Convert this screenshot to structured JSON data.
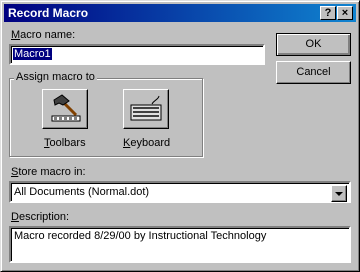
{
  "window": {
    "title": "Record Macro",
    "help_label": "?",
    "close_label": "×"
  },
  "form": {
    "macro_name_prefix": "M",
    "macro_name_rest": "acro name:",
    "macro_name_value": "Macro1",
    "assign_legend": "Assign macro to",
    "toolbars_prefix": "T",
    "toolbars_rest": "oolbars",
    "keyboard_prefix": "K",
    "keyboard_rest": "eyboard",
    "store_prefix": "S",
    "store_rest": "tore macro in:",
    "store_value": "All Documents (Normal.dot)",
    "description_prefix": "D",
    "description_rest": "escription:",
    "description_value": "Macro recorded 8/29/00 by Instructional Technology"
  },
  "buttons": {
    "ok": "OK",
    "cancel": "Cancel"
  },
  "icons": {
    "toolbars": "hammer-icon",
    "keyboard": "keyboard-icon"
  }
}
